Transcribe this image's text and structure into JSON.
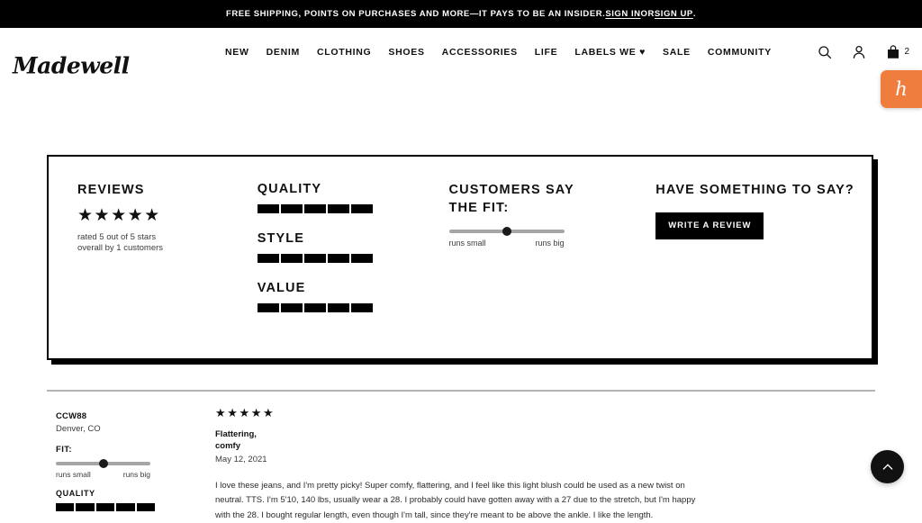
{
  "promo": {
    "text_before": "FREE SHIPPING, POINTS ON PURCHASES AND MORE—IT PAYS TO BE AN INSIDER. ",
    "sign_in": "SIGN IN",
    "between": " OR ",
    "sign_up": "SIGN UP",
    "after": "."
  },
  "header": {
    "logo": "Madewell",
    "nav": [
      {
        "label": "NEW"
      },
      {
        "label": "DENIM"
      },
      {
        "label": "CLOTHING"
      },
      {
        "label": "SHOES"
      },
      {
        "label": "ACCESSORIES"
      },
      {
        "label": "LIFE"
      },
      {
        "label": "LABELS WE ♥"
      },
      {
        "label": "SALE"
      },
      {
        "label": "COMMUNITY"
      }
    ],
    "icons": {
      "search": "search-icon",
      "account": "account-icon",
      "bag": "shopping-bag-icon"
    },
    "bag_count": "2"
  },
  "extension": {
    "honey_glyph": "h",
    "color": "#ef7d3d"
  },
  "summary": {
    "reviews": {
      "title": "REVIEWS",
      "stars": "★★★★★",
      "star_value": 5,
      "star_max": 5,
      "sub_line1": "rated 5 out of 5 stars",
      "sub_line2": "overall by 1 customers"
    },
    "ratings": [
      {
        "label": "QUALITY",
        "filled": 5,
        "total": 5
      },
      {
        "label": "STYLE",
        "filled": 5,
        "total": 5
      },
      {
        "label": "VALUE",
        "filled": 5,
        "total": 5
      }
    ],
    "fit": {
      "title_line1": "CUSTOMERS SAY",
      "title_line2": "THE FIT:",
      "left_label": "runs small",
      "right_label": "runs big",
      "position_pct": 50
    },
    "cta": {
      "title": "HAVE SOMETHING TO SAY?",
      "button": "WRITE A REVIEW"
    }
  },
  "review": {
    "author": "CCW88",
    "location": "Denver, CO",
    "fit_label": "FIT:",
    "fit_left": "runs small",
    "fit_right": "runs big",
    "fit_position_pct": 50,
    "quality_label": "QUALITY",
    "quality_filled": 5,
    "quality_total": 5,
    "stars": "★★★★★",
    "star_value": 5,
    "title_line1": "Flattering,",
    "title_line2": "comfy",
    "date": "May 12, 2021",
    "body": "I love these jeans, and I'm pretty picky! Super comfy, flattering, and I feel like this light blush could be used as a new twist on neutral. TTS. I'm 5'10, 140 lbs, usually wear a 28. I probably could have gotten away with a 27 due to the stretch, but I'm happy with the 28. I bought regular length, even though I'm tall, since they're meant to be above the ankle. I like the length."
  },
  "scroll_top": {
    "icon": "chevron-up-icon"
  }
}
